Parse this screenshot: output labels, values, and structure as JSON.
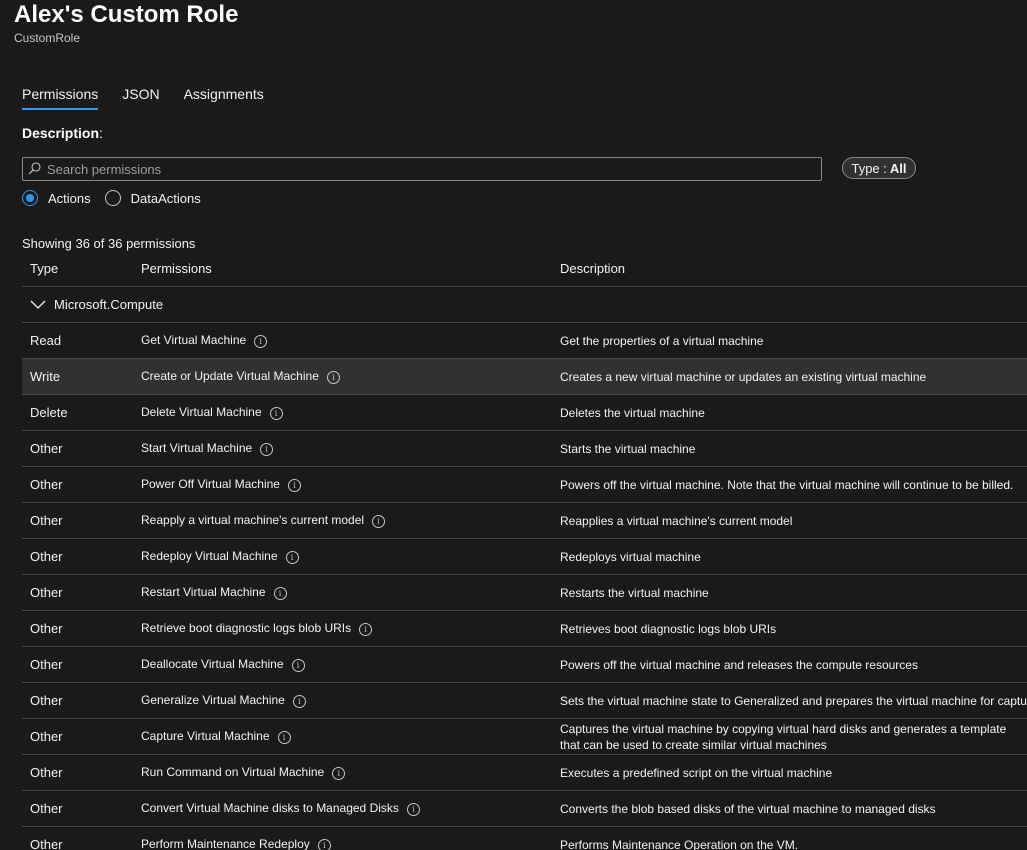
{
  "header": {
    "title": "Alex's Custom Role",
    "subtitle": "CustomRole"
  },
  "tabs": [
    {
      "label": "Permissions",
      "active": true
    },
    {
      "label": "JSON",
      "active": false
    },
    {
      "label": "Assignments",
      "active": false
    }
  ],
  "description_label": "Description",
  "search": {
    "placeholder": "Search permissions"
  },
  "type_filter": {
    "prefix": "Type :",
    "value": "All"
  },
  "radios": [
    {
      "label": "Actions",
      "checked": true
    },
    {
      "label": "DataActions",
      "checked": false
    }
  ],
  "showing_text": "Showing 36 of 36 permissions",
  "table": {
    "headers": {
      "type": "Type",
      "permissions": "Permissions",
      "description": "Description"
    },
    "group": {
      "label": "Microsoft.Compute",
      "expanded": true
    },
    "rows": [
      {
        "type": "Read",
        "permission": "Get Virtual Machine",
        "description": "Get the properties of a virtual machine"
      },
      {
        "type": "Write",
        "permission": "Create or Update Virtual Machine",
        "description": "Creates a new virtual machine or updates an existing virtual machine",
        "highlighted": true
      },
      {
        "type": "Delete",
        "permission": "Delete Virtual Machine",
        "description": "Deletes the virtual machine"
      },
      {
        "type": "Other",
        "permission": "Start Virtual Machine",
        "description": "Starts the virtual machine"
      },
      {
        "type": "Other",
        "permission": "Power Off Virtual Machine",
        "description": "Powers off the virtual machine. Note that the virtual machine will continue to be billed."
      },
      {
        "type": "Other",
        "permission": "Reapply a virtual machine's current model",
        "description": "Reapplies a virtual machine's current model"
      },
      {
        "type": "Other",
        "permission": "Redeploy Virtual Machine",
        "description": "Redeploys virtual machine"
      },
      {
        "type": "Other",
        "permission": "Restart Virtual Machine",
        "description": "Restarts the virtual machine"
      },
      {
        "type": "Other",
        "permission": "Retrieve boot diagnostic logs blob URIs",
        "description": "Retrieves boot diagnostic logs blob URIs"
      },
      {
        "type": "Other",
        "permission": "Deallocate Virtual Machine",
        "description": "Powers off the virtual machine and releases the compute resources"
      },
      {
        "type": "Other",
        "permission": "Generalize Virtual Machine",
        "description": "Sets the virtual machine state to Generalized and prepares the virtual machine for capture"
      },
      {
        "type": "Other",
        "permission": "Capture Virtual Machine",
        "description": "Captures the virtual machine by copying virtual hard disks and generates a template that can be used to create similar virtual machines"
      },
      {
        "type": "Other",
        "permission": "Run Command on Virtual Machine",
        "description": "Executes a predefined script on the virtual machine"
      },
      {
        "type": "Other",
        "permission": "Convert Virtual Machine disks to Managed Disks",
        "description": "Converts the blob based disks of the virtual machine to managed disks"
      },
      {
        "type": "Other",
        "permission": "Perform Maintenance Redeploy",
        "description": "Performs Maintenance Operation on the VM."
      }
    ]
  },
  "colors": {
    "accent": "#2899f5",
    "background": "#1b1a19",
    "row_highlight": "#323130"
  }
}
